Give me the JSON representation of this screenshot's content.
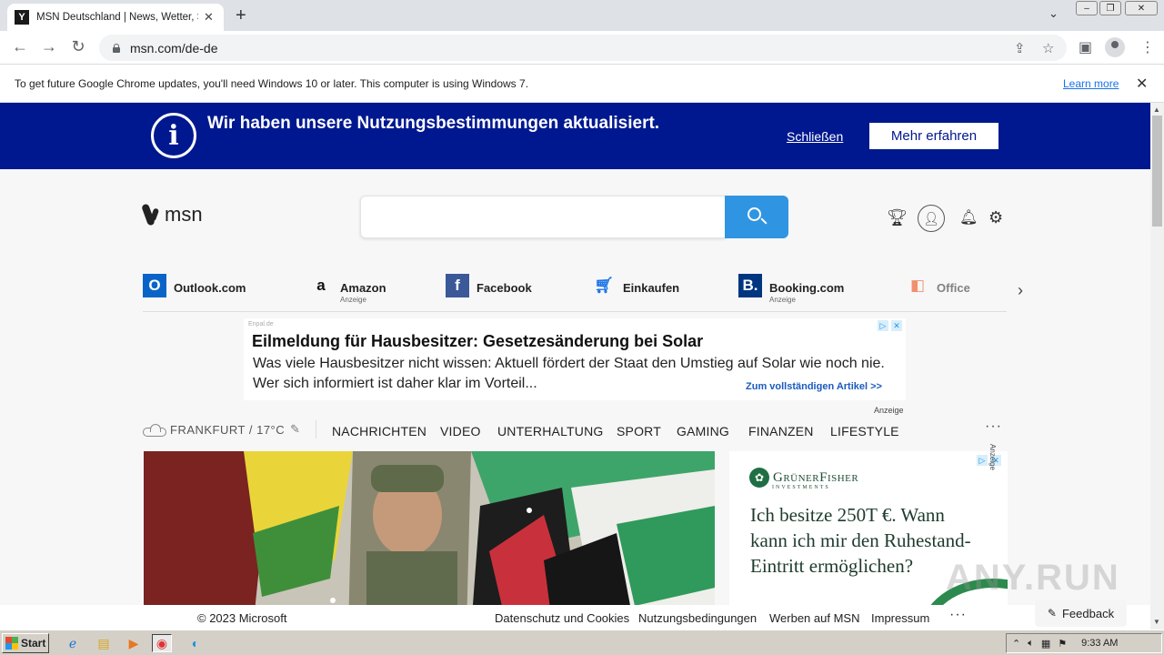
{
  "browser": {
    "tab_title": "MSN Deutschland | News, Wetter, Sport",
    "tab_favicon": "Y",
    "url": "msn.com/de-de",
    "infobar_text": "To get future Google Chrome updates, you'll need Windows 10 or later. This computer is using Windows 7.",
    "infobar_link": "Learn more"
  },
  "notice": {
    "text": "Wir haben unsere Nutzungsbestimmungen aktualisiert.",
    "close_label": "Schließen",
    "more_label": "Mehr erfahren"
  },
  "header": {
    "logo_text": "msn"
  },
  "quicklinks": [
    {
      "label": "Outlook.com",
      "sub": "",
      "icon": "outlook-icon",
      "color": "#0a64c7"
    },
    {
      "label": "Amazon",
      "sub": "Anzeige",
      "icon": "amazon-icon",
      "color": "#111111"
    },
    {
      "label": "Facebook",
      "sub": "",
      "icon": "facebook-icon",
      "color": "#3b5998"
    },
    {
      "label": "Einkaufen",
      "sub": "",
      "icon": "shopping-cart-icon",
      "color": "#1a73e8"
    },
    {
      "label": "Booking.com",
      "sub": "Anzeige",
      "icon": "booking-icon",
      "color": "#003580"
    },
    {
      "label": "Office",
      "sub": "",
      "icon": "office-icon",
      "color": "#eb3c00"
    }
  ],
  "ad": {
    "source": "Enpal.de",
    "headline": "Eilmeldung für Hausbesitzer: Gesetzesänderung bei Solar",
    "body": "Was viele Hausbesitzer nicht wissen: Aktuell fördert der Staat den Umstieg auf Solar wie noch nie. Wer sich informiert ist daher klar im Vorteil...",
    "cta": "Zum vollständigen Artikel >>",
    "tag": "Anzeige"
  },
  "nav": {
    "weather": "FRANKFURT / 17°C",
    "items": [
      "NACHRICHTEN",
      "VIDEO",
      "UNTERHALTUNG",
      "SPORT",
      "GAMING",
      "FINANZEN",
      "LIFESTYLE"
    ],
    "more": "···"
  },
  "sidead": {
    "brand": "GrünerFisher",
    "brand_sub": "INVESTMENTS",
    "headline": "Ich besitze 250T €. Wann kann ich mir den Ruhestand-Eintritt ermöglichen?",
    "tag": "Anzeige"
  },
  "footer": {
    "copyright": "© 2023 Microsoft",
    "links": [
      "Datenschutz und Cookies",
      "Nutzungsbedingungen",
      "Werben auf MSN",
      "Impressum"
    ],
    "more": "···",
    "feedback": "Feedback"
  },
  "watermark": "ANY.RUN",
  "taskbar": {
    "start_label": "Start",
    "clock": "9:33 AM"
  }
}
